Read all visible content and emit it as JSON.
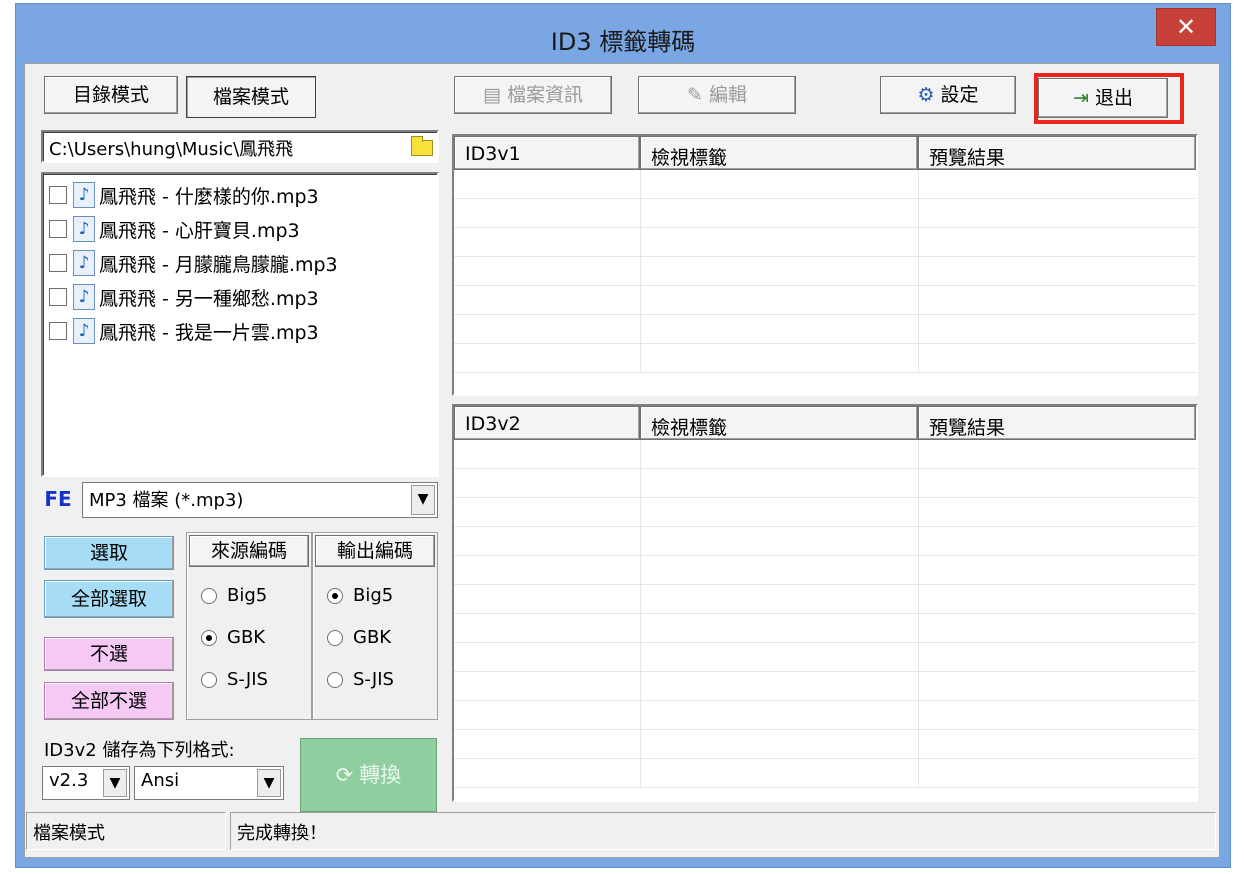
{
  "window": {
    "title": "ID3 標籤轉碼",
    "close_label": "✕"
  },
  "mode_buttons": {
    "dir_mode": "目錄模式",
    "file_mode": "檔案模式"
  },
  "toolbar": {
    "file_info": "檔案資訊",
    "edit": "編輯",
    "settings": "設定",
    "exit": "退出"
  },
  "path": "C:\\Users\\hung\\Music\\鳳飛飛",
  "files": [
    "鳳飛飛 - 什麼樣的你.mp3",
    "鳳飛飛 - 心肝寶貝.mp3",
    "鳳飛飛 - 月朦朧鳥朦朧.mp3",
    "鳳飛飛 - 另一種鄉愁.mp3",
    "鳳飛飛 - 我是一片雲.mp3"
  ],
  "filter": {
    "label": "FE",
    "value": "MP3 檔案 (*.mp3)"
  },
  "select_buttons": {
    "select": "選取",
    "select_all": "全部選取",
    "deselect": "不選",
    "deselect_all": "全部不選"
  },
  "source_encoding": {
    "header": "來源編碼",
    "options": [
      "Big5",
      "GBK",
      "S-JIS"
    ],
    "selected": "GBK"
  },
  "output_encoding": {
    "header": "輸出編碼",
    "options": [
      "Big5",
      "GBK",
      "S-JIS"
    ],
    "selected": "Big5"
  },
  "save_format": {
    "label": "ID3v2 儲存為下列格式:",
    "version": "v2.3",
    "charset": "Ansi"
  },
  "convert_label": "轉換",
  "grid_v1": {
    "headers": [
      "ID3v1",
      "檢視標籤",
      "預覽結果"
    ]
  },
  "grid_v2": {
    "headers": [
      "ID3v2",
      "檢視標籤",
      "預覽結果"
    ]
  },
  "status": {
    "mode": "檔案模式",
    "message": "完成轉換！"
  },
  "colors": {
    "title_bar": "#7aa7e4",
    "close": "#c7403a",
    "highlight": "#e8261e",
    "blue_button": "#a7dcf6",
    "pink_button": "#f6c9f5",
    "convert_button": "#8fcf9f"
  }
}
